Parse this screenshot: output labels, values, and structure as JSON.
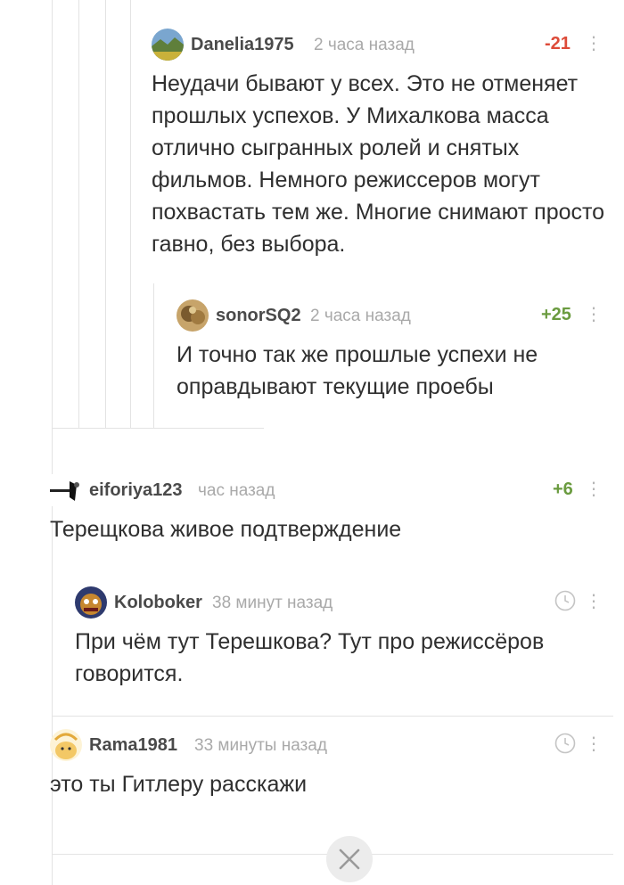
{
  "comments": [
    {
      "user": "Danelia1975",
      "time": "2 часа назад",
      "rating": "-21",
      "text": "Неудачи бывают у всех. Это не отменяет прошлых успехов. У Михалкова масса отлично сыгранных ролей и снятых фильмов. Немного режиссеров могут похвастать тем же. Многие снимают просто гавно, без выбора."
    },
    {
      "user": "sonorSQ2",
      "time": "2 часа назад",
      "rating": "+25",
      "text": "И точно так же прошлые успехи не оправдывают текущие проебы"
    },
    {
      "user": "eiforiya123",
      "time": "час назад",
      "rating": "+6",
      "text": "Терещкова живое подтверждение"
    },
    {
      "user": "Koloboker",
      "time": "38 минут назад",
      "text": "При чём тут Терешкова? Тут про режиссёров говорится."
    },
    {
      "user": "Rama1981",
      "time": "33 минуты назад",
      "text": "это ты Гитлеру расскажи"
    }
  ],
  "colors": {
    "negative": "#dd4b39",
    "positive": "#6a9b3f",
    "thread_line": "#e3e3e3"
  },
  "icons": {
    "menu": "more-vertical-icon",
    "pending": "clock-icon",
    "close": "close-icon"
  }
}
